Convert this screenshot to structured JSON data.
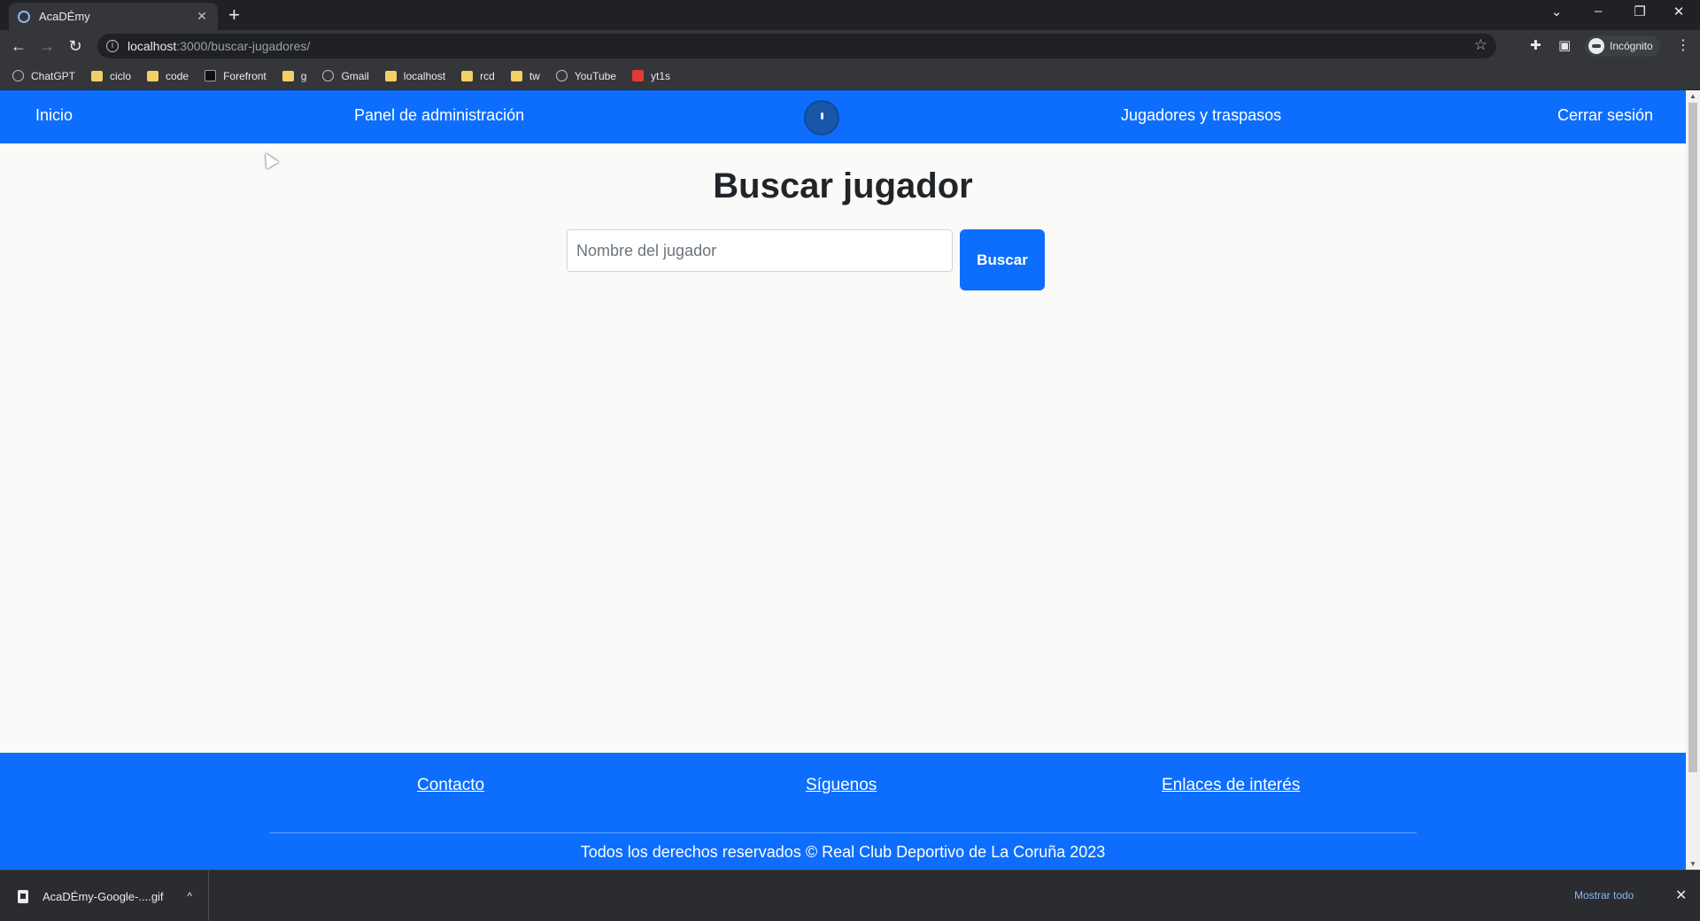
{
  "browser": {
    "tab_title": "AcaDÉmy",
    "tab_close": "✕",
    "new_tab": "+",
    "url_host": "localhost",
    "url_path": ":3000/buscar-jugadores/",
    "profile_label": "Incógnito",
    "window_controls": {
      "tabs_menu": "⌄",
      "minimize": "–",
      "restore": "❐",
      "close": "✕"
    },
    "bookmarks": [
      {
        "label": "ChatGPT",
        "icon": "globe"
      },
      {
        "label": "ciclo",
        "icon": "folder"
      },
      {
        "label": "code",
        "icon": "folder"
      },
      {
        "label": "Forefront",
        "icon": "forefront"
      },
      {
        "label": "g",
        "icon": "folder"
      },
      {
        "label": "Gmail",
        "icon": "globe"
      },
      {
        "label": "localhost",
        "icon": "folder"
      },
      {
        "label": "rcd",
        "icon": "folder"
      },
      {
        "label": "tw",
        "icon": "folder"
      },
      {
        "label": "YouTube",
        "icon": "globe"
      },
      {
        "label": "yt1s",
        "icon": "yt1s"
      }
    ]
  },
  "site": {
    "nav": {
      "home": "Inicio",
      "admin_panel": "Panel de administración",
      "players_transfers": "Jugadores y traspasos",
      "logout": "Cerrar sesión"
    },
    "page_title": "Buscar jugador",
    "search": {
      "placeholder": "Nombre del jugador",
      "button": "Buscar"
    },
    "footer": {
      "contact": "Contacto",
      "follow": "Síguenos",
      "links": "Enlaces de interés",
      "copyright": "Todos los derechos reservados © Real Club Deportivo de La Coruña 2023"
    }
  },
  "downloads": {
    "file_name": "AcaDÉmy-Google-....gif",
    "show_all": "Mostrar todo"
  },
  "colors": {
    "brand_blue": "#0d6efd",
    "chrome_dark": "#202124",
    "chrome_bar": "#35363a"
  }
}
